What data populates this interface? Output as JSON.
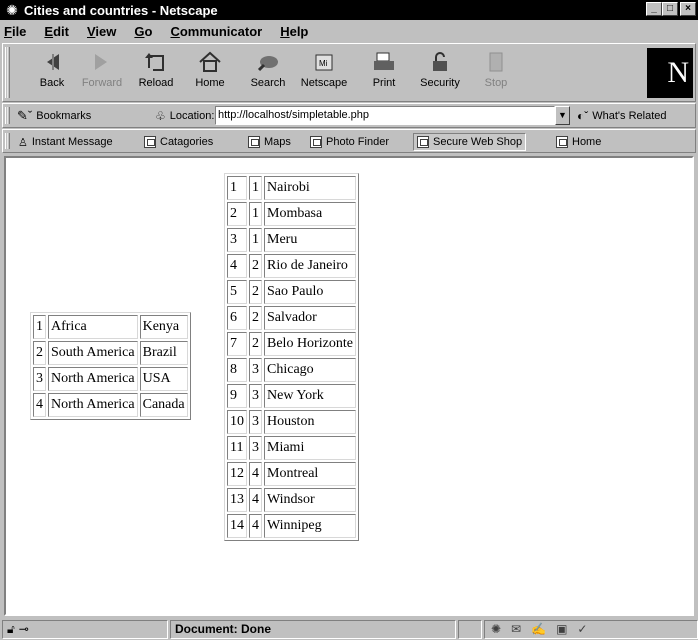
{
  "window": {
    "title": "Cities and countries - Netscape"
  },
  "menu": [
    "File",
    "Edit",
    "View",
    "Go",
    "Communicator",
    "Help"
  ],
  "nav": {
    "back": "Back",
    "forward": "Forward",
    "reload": "Reload",
    "home": "Home",
    "search": "Search",
    "netscape": "Netscape",
    "print": "Print",
    "security": "Security",
    "stop": "Stop",
    "logo": "N"
  },
  "location": {
    "bookmarks": "Bookmarks",
    "label": "Location:",
    "url": "http://localhost/simpletable.php",
    "related": "What's Related"
  },
  "personal": [
    "Instant Message",
    "Catagories",
    "Maps",
    "Photo Finder",
    "Secure Web Shop",
    "Home"
  ],
  "countries": [
    [
      "1",
      "Africa",
      "Kenya"
    ],
    [
      "2",
      "South America",
      "Brazil"
    ],
    [
      "3",
      "North America",
      "USA"
    ],
    [
      "4",
      "North America",
      "Canada"
    ]
  ],
  "cities": [
    [
      "1",
      "1",
      "Nairobi"
    ],
    [
      "2",
      "1",
      "Mombasa"
    ],
    [
      "3",
      "1",
      "Meru"
    ],
    [
      "4",
      "2",
      "Rio de Janeiro"
    ],
    [
      "5",
      "2",
      "Sao Paulo"
    ],
    [
      "6",
      "2",
      "Salvador"
    ],
    [
      "7",
      "2",
      "Belo Horizonte"
    ],
    [
      "8",
      "3",
      "Chicago"
    ],
    [
      "9",
      "3",
      "New York"
    ],
    [
      "10",
      "3",
      "Houston"
    ],
    [
      "11",
      "3",
      "Miami"
    ],
    [
      "12",
      "4",
      "Montreal"
    ],
    [
      "13",
      "4",
      "Windsor"
    ],
    [
      "14",
      "4",
      "Winnipeg"
    ]
  ],
  "status": {
    "text": "Document: Done"
  }
}
